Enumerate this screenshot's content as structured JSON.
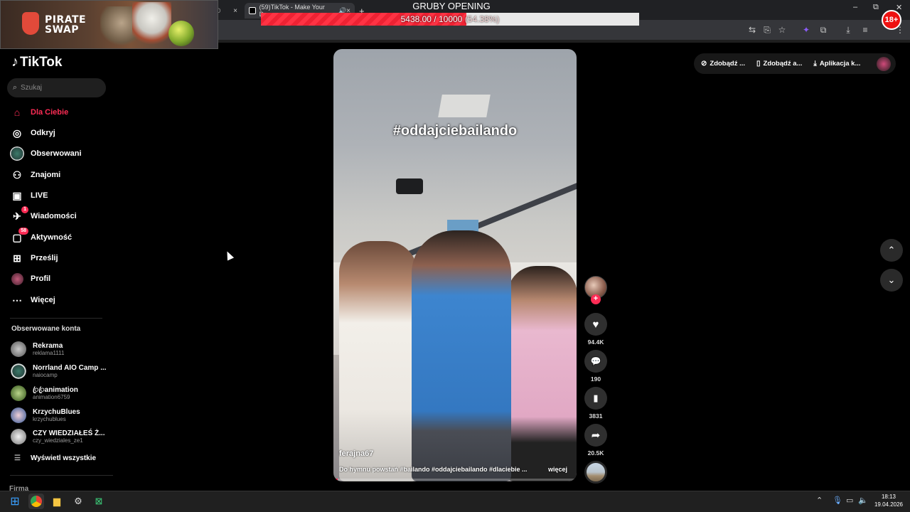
{
  "browser": {
    "tab_label": "(59)TikTok - Make Your Day",
    "tab_close": "×",
    "tab_close_left": "×",
    "tab_prev_suffix": "D",
    "new_tab": "+",
    "minimize": "–",
    "maximize": "⧉",
    "close": "✕"
  },
  "overlay": {
    "brand_line1": "PIRATE",
    "brand_line2": "SWAP",
    "opening_title": "GRUBY OPENING",
    "progress_value_text": "5438.00 / 10000",
    "progress_percent_text": "(54.38%)",
    "progress_fraction": 0.5438,
    "age_badge": "18+"
  },
  "tiktok": {
    "logo": "TikTok",
    "search_placeholder": "Szukaj",
    "nav": [
      {
        "label": "Dla Ciebie",
        "icon": "home-icon",
        "active": true
      },
      {
        "label": "Odkryj",
        "icon": "compass-icon"
      },
      {
        "label": "Obserwowani",
        "icon": "followed-avatar-icon"
      },
      {
        "label": "Znajomi",
        "icon": "friends-icon"
      },
      {
        "label": "LIVE",
        "icon": "live-icon"
      },
      {
        "label": "Wiadomości",
        "icon": "messages-icon",
        "badge": "1"
      },
      {
        "label": "Aktywność",
        "icon": "activity-icon",
        "badge": "58"
      },
      {
        "label": "Prześlij",
        "icon": "upload-icon"
      },
      {
        "label": "Profil",
        "icon": "profile-avatar-icon"
      },
      {
        "label": "Więcej",
        "icon": "more-icon"
      }
    ],
    "followed_title": "Obserwowane konta",
    "followed_accounts": [
      {
        "name": "Rekrama",
        "handle": "reklama1111"
      },
      {
        "name": "Norrland AIO Camp ...",
        "handle": "naiocamp"
      },
      {
        "name": "ꦿꦿanimation",
        "handle": "animation6759"
      },
      {
        "name": "KrzychuBlues",
        "handle": "krzychublues"
      },
      {
        "name": "CZY WIEDZIAŁEŚ Ż...",
        "handle": "czy_wiedziales_ze1"
      }
    ],
    "show_all": "Wyświetl wszystkie",
    "footer_section": "Firma",
    "top_right": {
      "item1": "Zdobądź ...",
      "item2": "Zdobądź a...",
      "item3": "Aplikacja k..."
    },
    "video": {
      "hashtag_overlay": "#oddajciebailando",
      "author": "ferajna67",
      "description": "Do hymnu powstań #bailando #oddajciebailando #dlaciebie ...",
      "more": "więcej",
      "likes": "94.4K",
      "comments": "190",
      "saves": "3831",
      "shares": "20.5K"
    }
  },
  "taskbar": {
    "time": "18:13",
    "date": "19.04.2026"
  },
  "colors": {
    "accent": "#fe2c55",
    "progress_fill": "#ff3344"
  }
}
